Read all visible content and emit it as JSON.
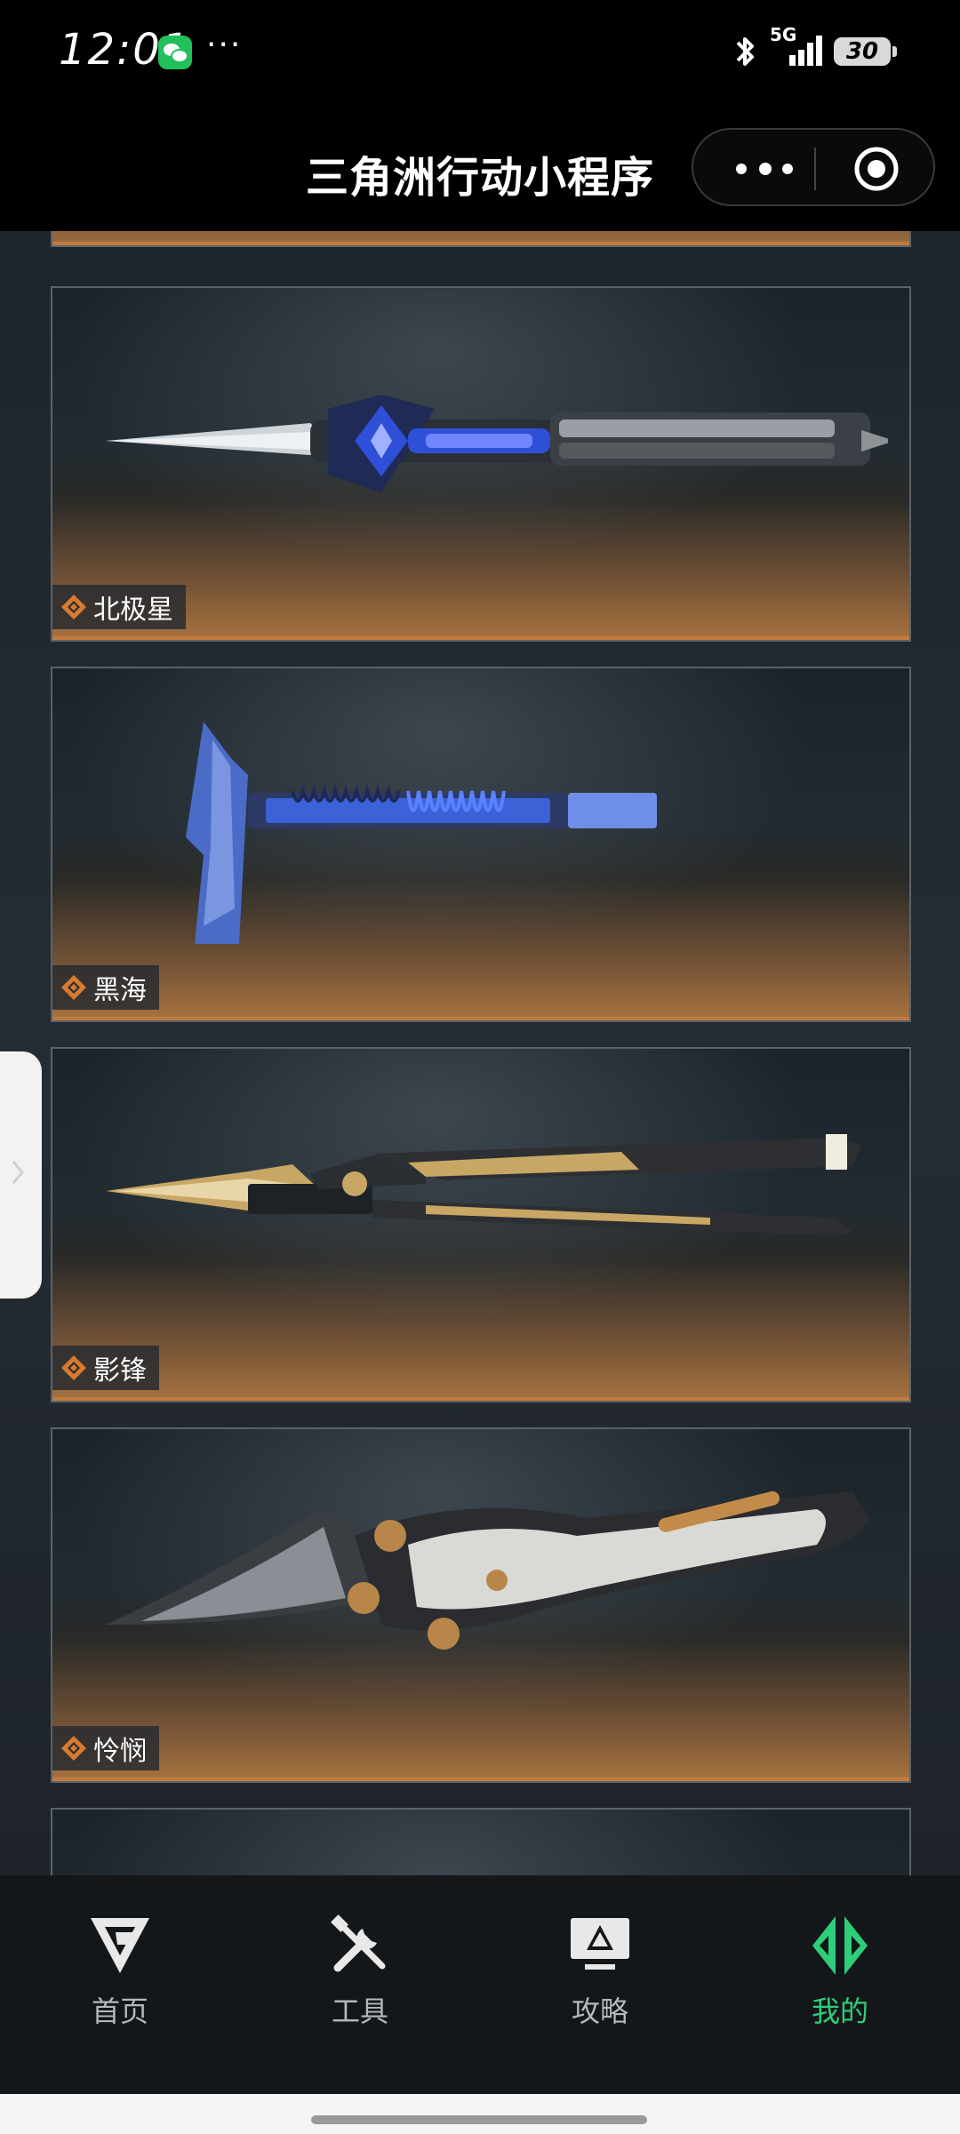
{
  "status_bar": {
    "time": "12:01",
    "more": "···",
    "signal": "5G",
    "battery": "30"
  },
  "nav": {
    "title": "三角洲行动小程序"
  },
  "cards": [
    {
      "label": "北极星",
      "weapon": "Desmoulins",
      "accent": "#2f4fd8"
    },
    {
      "label": "黑海",
      "weapon": "axe",
      "accent": "#3b62d6"
    },
    {
      "label": "影锋",
      "weapon": "COBRA",
      "accent": "#c8a765"
    },
    {
      "label": "怜悯",
      "weapon": "karambit",
      "accent": "#b9864a"
    }
  ],
  "tabs": [
    {
      "label": "首页",
      "icon": "delta-logo-icon"
    },
    {
      "label": "工具",
      "icon": "tools-icon"
    },
    {
      "label": "攻略",
      "icon": "guide-monitor-icon"
    },
    {
      "label": "我的",
      "icon": "profile-logo-icon",
      "active": true
    }
  ],
  "colors": {
    "active_tab": "#2ecf79",
    "card_bottom": "#c27a3d",
    "background": "#1a1f24"
  }
}
